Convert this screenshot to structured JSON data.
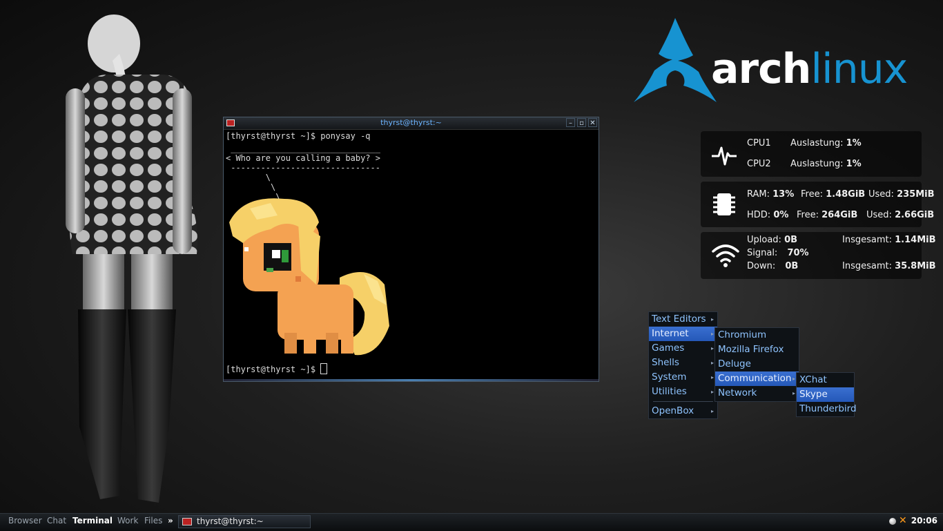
{
  "logo": {
    "word1": "arch",
    "word2": "linux",
    "brand_color": "#1793d1"
  },
  "terminal": {
    "title": "thyrst@thyrst:~",
    "lines": [
      "[thyrst@thyrst ~]$ ponysay -q",
      " ______________________________",
      "< Who are you calling a baby? >",
      " ------------------------------",
      "        \\",
      "         \\",
      "          \\"
    ],
    "prompt": "[thyrst@thyrst ~]$ "
  },
  "conky": {
    "cpu": {
      "cpu1_label": "CPU1",
      "cpu1_text": "Auslastung:",
      "cpu1_value": "1%",
      "cpu2_label": "CPU2",
      "cpu2_text": "Auslastung:",
      "cpu2_value": "1%"
    },
    "mem": {
      "ram_label": "RAM:",
      "ram_pct": "13%",
      "ram_free_label": "Free:",
      "ram_free": "1.48GiB",
      "ram_used_label": "Used:",
      "ram_used": "235MiB",
      "hdd_label": "HDD:",
      "hdd_pct": "0%",
      "hdd_free_label": "Free:",
      "hdd_free": "264GiB",
      "hdd_used_label": "Used:",
      "hdd_used": "2.66GiB"
    },
    "net": {
      "up_label": "Upload:",
      "up_value": "0B",
      "up_total_label": "Insgesamt:",
      "up_total": "1.14MiB",
      "signal_label": "Signal:",
      "signal_value": "70%",
      "down_label": "Down:",
      "down_value": "0B",
      "down_total_label": "Insgesamt:",
      "down_total": "35.8MiB"
    }
  },
  "menu": {
    "root": [
      "Text Editors",
      "Internet",
      "Games",
      "Shells",
      "System",
      "Utilities",
      "OpenBox"
    ],
    "internet": [
      "Chromium",
      "Mozilla Firefox",
      "Deluge",
      "Communication",
      "Network"
    ],
    "communication": [
      "XChat",
      "Skype",
      "Thunderbird"
    ]
  },
  "taskbar": {
    "workspaces": [
      "Browser",
      "Chat",
      "Terminal",
      "Work",
      "Files"
    ],
    "more": "»",
    "task_label": "thyrst@thyrst:~",
    "clock": "20:06"
  }
}
